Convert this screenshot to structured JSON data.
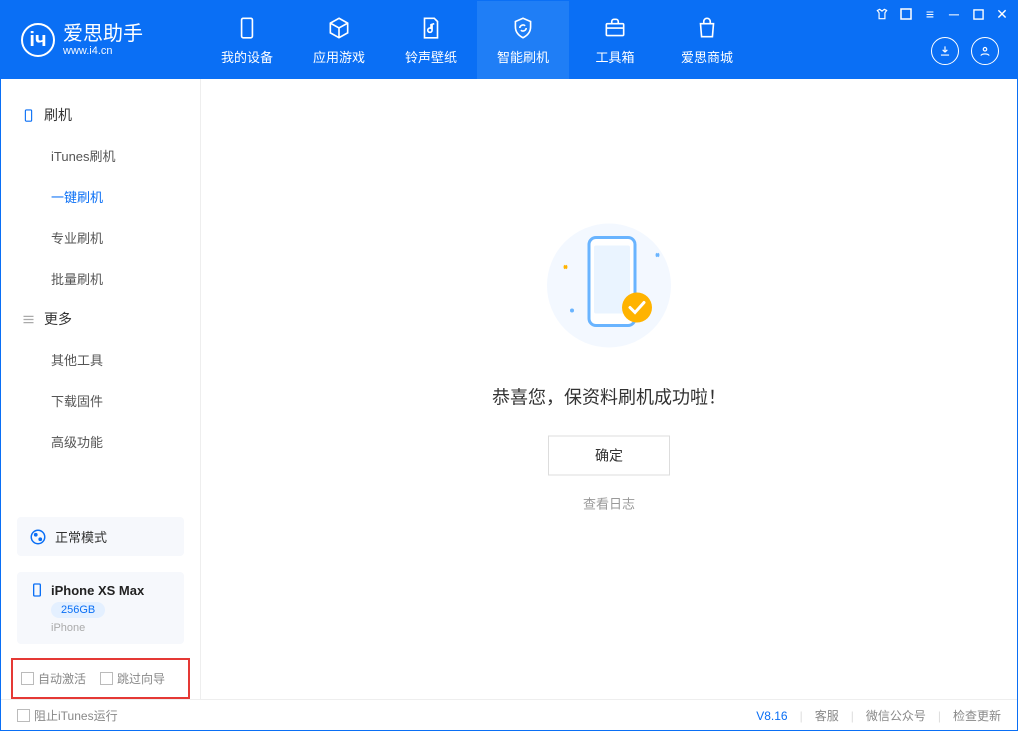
{
  "app": {
    "title": "爱思助手",
    "subtitle": "www.i4.cn"
  },
  "nav": {
    "my_device": "我的设备",
    "apps": "应用游戏",
    "ringtones": "铃声壁纸",
    "flash": "智能刷机",
    "toolbox": "工具箱",
    "store": "爱思商城"
  },
  "sidebar": {
    "group_flash": "刷机",
    "items_flash": [
      "iTunes刷机",
      "一键刷机",
      "专业刷机",
      "批量刷机"
    ],
    "group_more": "更多",
    "items_more": [
      "其他工具",
      "下载固件",
      "高级功能"
    ]
  },
  "mode": "正常模式",
  "device": {
    "name": "iPhone XS Max",
    "capacity": "256GB",
    "type": "iPhone"
  },
  "options": {
    "auto_activate": "自动激活",
    "skip_guide": "跳过向导"
  },
  "result": {
    "message": "恭喜您，保资料刷机成功啦！",
    "ok": "确定",
    "log": "查看日志"
  },
  "footer": {
    "block_itunes": "阻止iTunes运行",
    "version": "V8.16",
    "service": "客服",
    "wechat": "微信公众号",
    "update": "检查更新"
  }
}
